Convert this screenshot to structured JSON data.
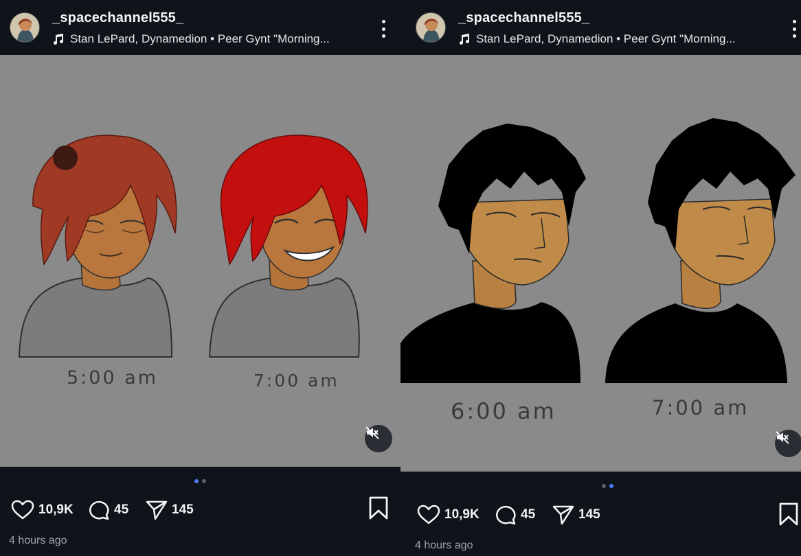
{
  "posts": [
    {
      "username": "_spacechannel555_",
      "track": "Stan LePard, Dynamedion • Peer Gynt \"Morning...",
      "captions": [
        "5:00 am",
        "7:00 am"
      ],
      "likes": "10,9K",
      "comments": "45",
      "shares": "145",
      "time_ago": "4 hours ago",
      "carousel_active_index": 0
    },
    {
      "username": "_spacechannel555_",
      "track": "Stan LePard, Dynamedion • Peer Gynt \"Morning...",
      "captions": [
        "6:00 am",
        "7:00 am"
      ],
      "likes": "10,9K",
      "comments": "45",
      "shares": "145",
      "time_ago": "4 hours ago",
      "carousel_active_index": 1
    }
  ],
  "icons": {
    "music": "music-note-icon",
    "more": "more-vertical-icon",
    "like": "heart-icon",
    "comment": "comment-icon",
    "share": "send-icon",
    "bookmark": "bookmark-icon",
    "mute": "speaker-muted-icon"
  },
  "colors": {
    "background": "#0f131a",
    "media_background": "#8a8a8a",
    "carousel_active": "#4c7dff",
    "text_secondary": "#9ea2aa"
  }
}
